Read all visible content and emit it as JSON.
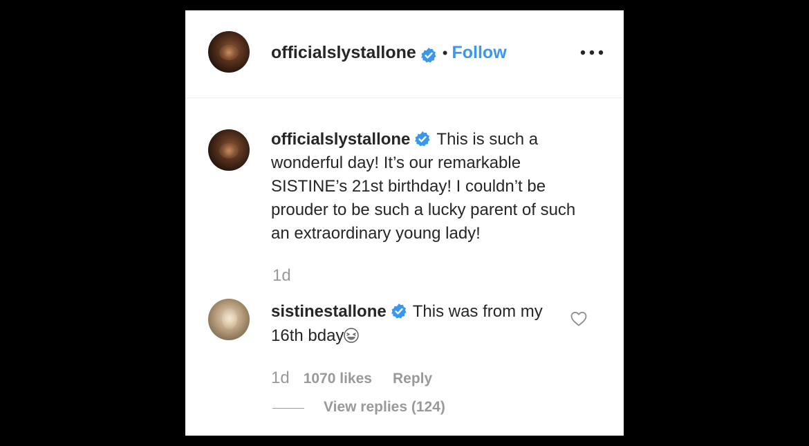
{
  "post": {
    "author": "officialslystallone",
    "separator": "•",
    "follow_label": "Follow",
    "more_icon": "more-options-icon"
  },
  "caption": {
    "author": "officialslystallone",
    "text": "This is such a wonderful day! It’s our remarkable SISTINE’s 21st birthday! I couldn’t be prouder to be such a lucky parent of such an extraordinary young lady!",
    "timestamp": "1d"
  },
  "comment": {
    "author": "sistinestallone",
    "text": "This was from my 16th bday",
    "emoji": "grinning-squinting-face-emoji",
    "timestamp": "1d",
    "likes": "1070 likes",
    "reply_label": "Reply",
    "view_replies": "View replies (124)"
  },
  "colors": {
    "accent": "#3897f0",
    "verified": "#3897f0",
    "text": "#262626",
    "muted": "#999999",
    "background": "#000000"
  }
}
